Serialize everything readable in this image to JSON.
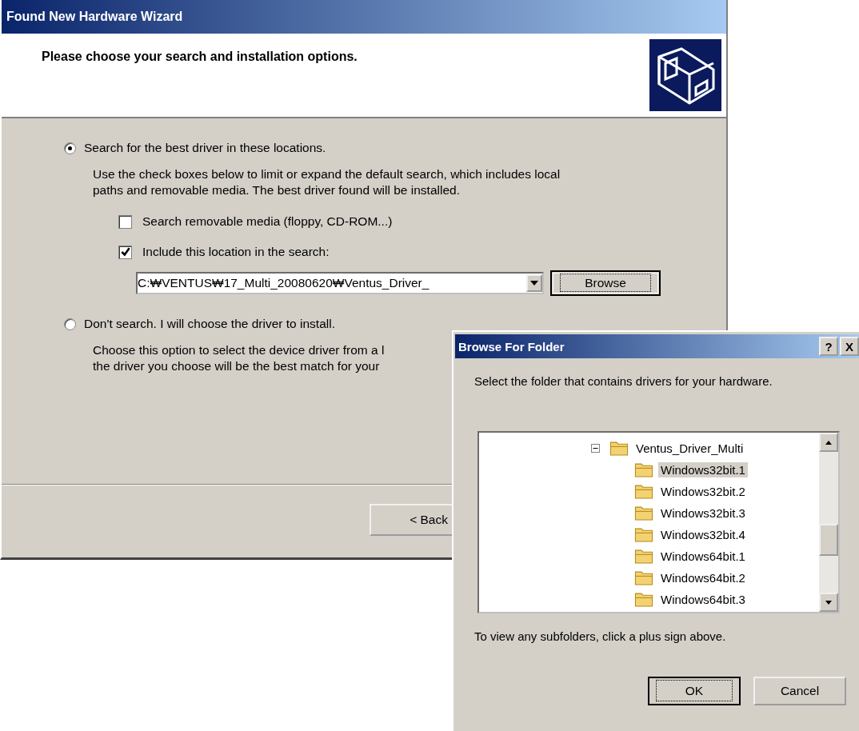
{
  "wizard": {
    "title": "Found New Hardware Wizard",
    "heading": "Please choose your search and installation options.",
    "options": [
      {
        "label": "Search for the best driver in these locations.",
        "selected": true,
        "description_lines": [
          "Use the check boxes below to limit or expand the default search, which includes local",
          "paths and removable media. The best driver found will be installed."
        ]
      },
      {
        "label": "Don't search. I will choose the driver to install.",
        "selected": false,
        "description_lines": [
          "Choose this option to select the device driver from a l",
          "the driver you choose will be the best match for your"
        ]
      }
    ],
    "checkboxes": [
      {
        "label": "Search removable media (floppy, CD-ROM...)",
        "checked": false
      },
      {
        "label": "Include this location in the search:",
        "checked": true
      }
    ],
    "location": {
      "value": "C:₩VENTUS₩17_Multi_20080620₩Ventus_Driver_"
    },
    "browse_button": "Browse",
    "back_button": "< Back"
  },
  "dialog": {
    "title": "Browse For Folder",
    "help_button": "?",
    "close_button": "X",
    "instruction": "Select the folder that contains drivers for your hardware.",
    "tree": {
      "label": "Ventus_Driver_Multi",
      "expanded": true,
      "children": [
        {
          "label": "Windows32bit.1",
          "selected": true
        },
        {
          "label": "Windows32bit.2",
          "selected": false
        },
        {
          "label": "Windows32bit.3",
          "selected": false
        },
        {
          "label": "Windows32bit.4",
          "selected": false
        },
        {
          "label": "Windows64bit.1",
          "selected": false
        },
        {
          "label": "Windows64bit.2",
          "selected": false
        },
        {
          "label": "Windows64bit.3",
          "selected": false
        }
      ]
    },
    "hint": "To view any subfolders, click a plus sign above.",
    "buttons": [
      "OK",
      "Cancel"
    ]
  }
}
